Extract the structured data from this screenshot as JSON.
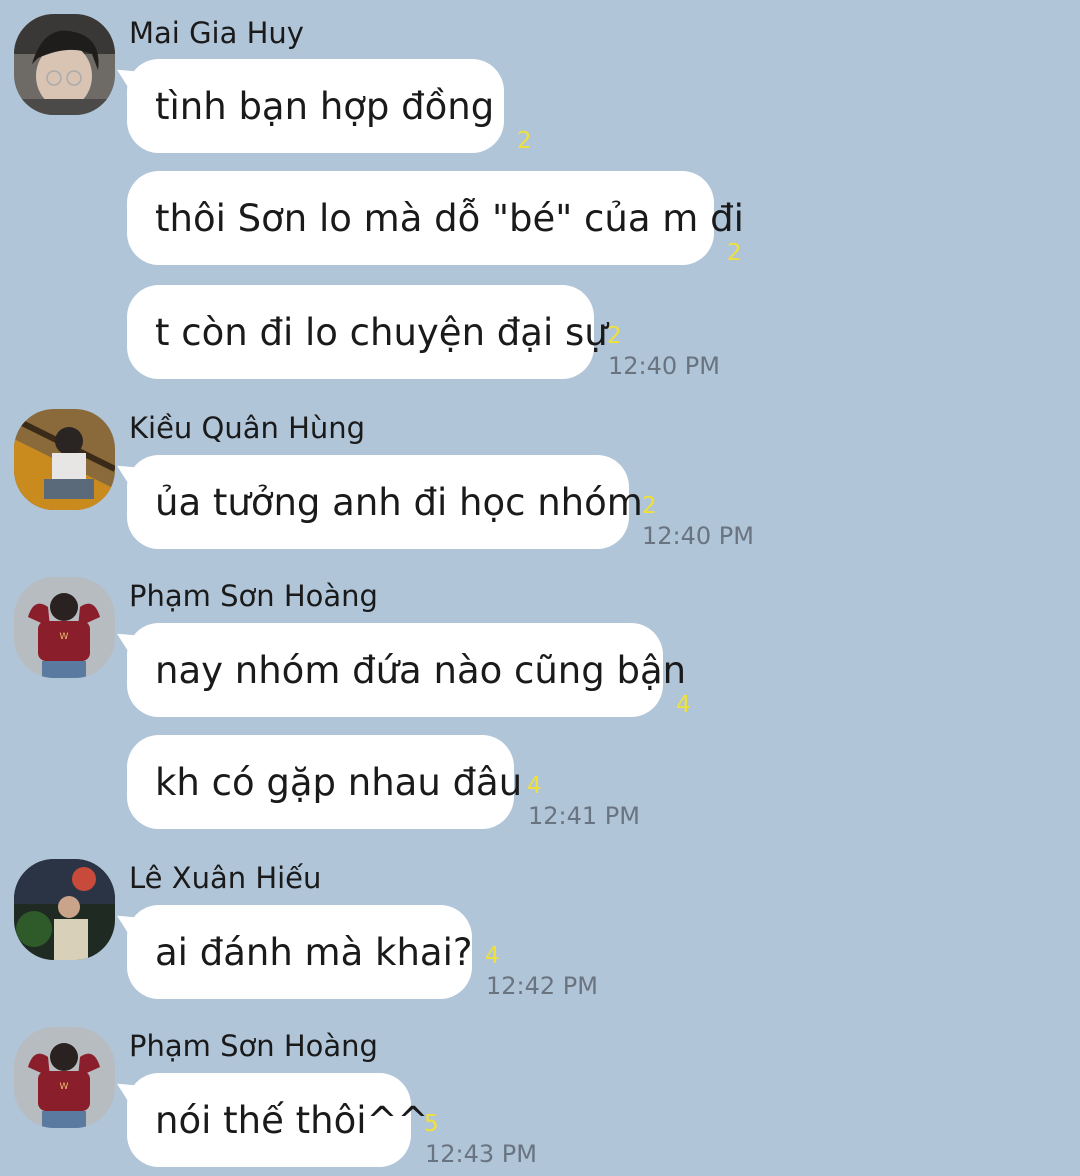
{
  "groups": [
    {
      "sender": "Mai Gia Huy",
      "avatar": "avatar-mai-gia-huy",
      "messages": [
        {
          "text": "tình bạn hợp đồng",
          "unread": "2",
          "time": ""
        },
        {
          "text": "thôi Sơn lo mà dỗ \"bé\" của m đi",
          "unread": "2",
          "time": ""
        },
        {
          "text": "t còn đi lo chuyện đại sự",
          "unread": "2",
          "time": "12:40 PM"
        }
      ]
    },
    {
      "sender": "Kiều Quân Hùng",
      "avatar": "avatar-kieu-quan-hung",
      "messages": [
        {
          "text": "ủa tưởng anh đi học nhóm",
          "unread": "2",
          "time": "12:40 PM"
        }
      ]
    },
    {
      "sender": "Phạm Sơn Hoàng",
      "avatar": "avatar-pham-son-hoang",
      "messages": [
        {
          "text": "nay nhóm đứa nào cũng bận",
          "unread": "4",
          "time": ""
        },
        {
          "text": "kh có gặp nhau đâu",
          "unread": "4",
          "time": "12:41 PM"
        }
      ]
    },
    {
      "sender": "Lê Xuân Hiếu",
      "avatar": "avatar-le-xuan-hieu",
      "messages": [
        {
          "text": "ai đánh mà khai?",
          "unread": "4",
          "time": "12:42 PM"
        }
      ]
    },
    {
      "sender": "Phạm Sơn Hoàng",
      "avatar": "avatar-pham-son-hoang",
      "messages": [
        {
          "text": "nói thế thôi^^",
          "unread": "5",
          "time": "12:43 PM"
        }
      ]
    }
  ],
  "colors": {
    "background": "#b1c5d9",
    "bubble": "#ffffff",
    "unread": "#f0e03a",
    "time": "#6a7480"
  }
}
